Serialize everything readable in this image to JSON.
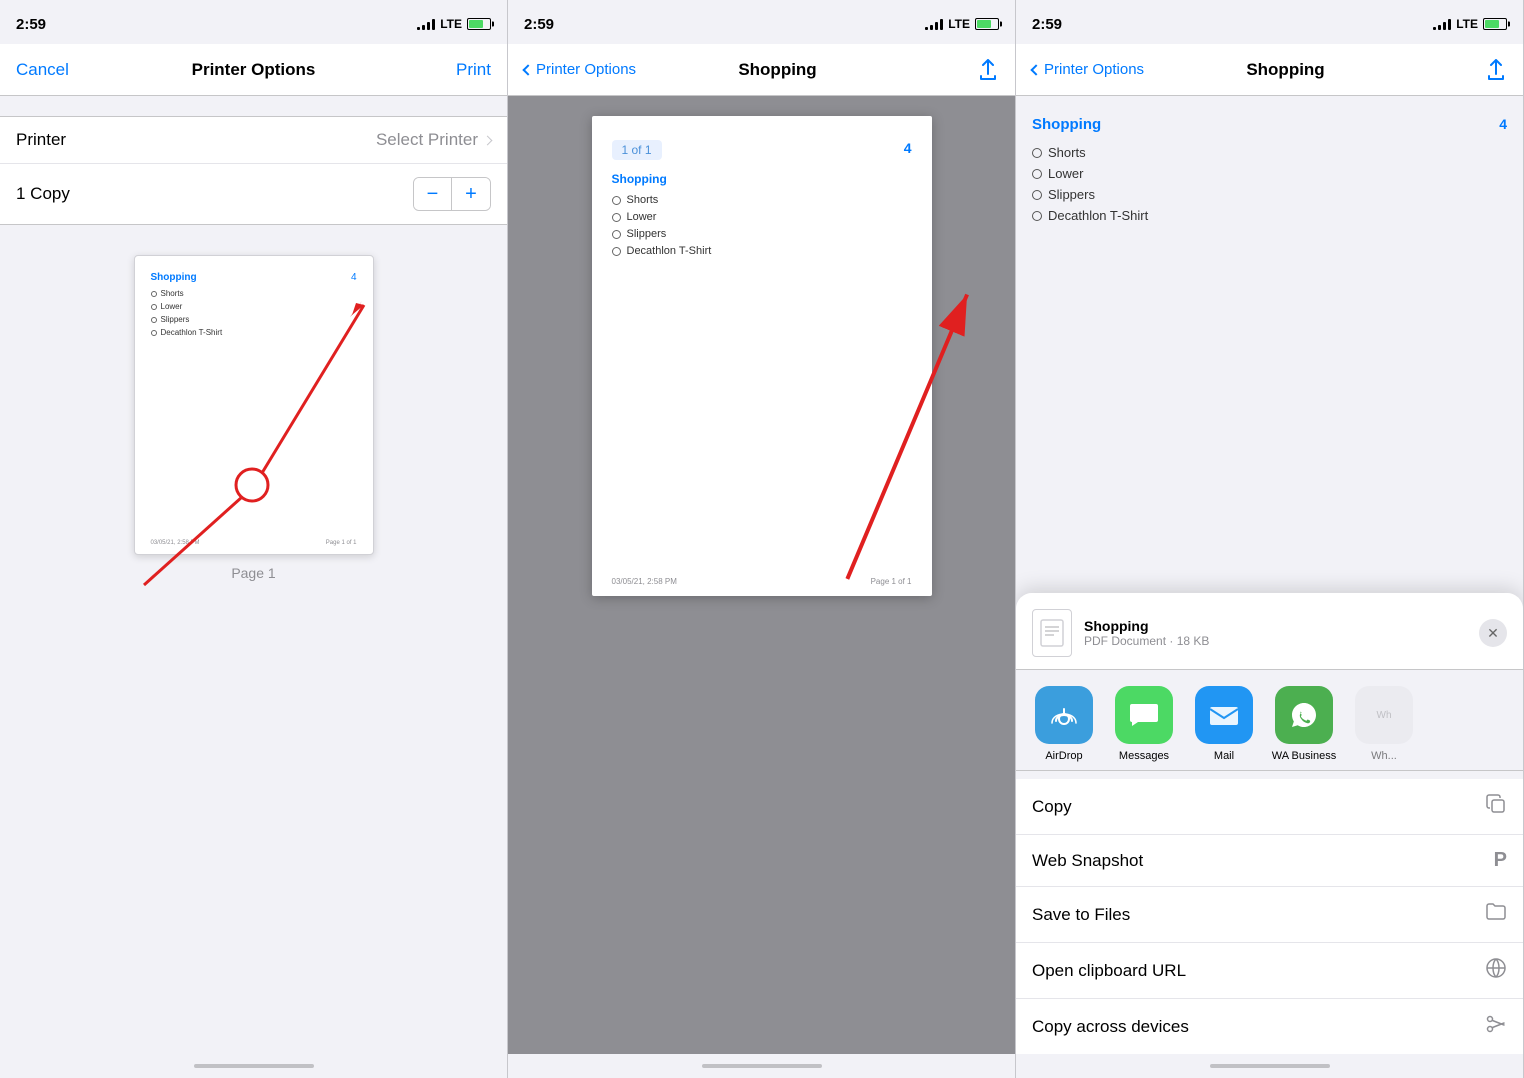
{
  "statusBar": {
    "time": "2:59",
    "lte": "LTE"
  },
  "panel1": {
    "navCancel": "Cancel",
    "navTitle": "Printer Options",
    "navPrint": "Print",
    "printerLabel": "Printer",
    "printerValue": "Select Printer",
    "copyLabel": "1 Copy",
    "pageLabel": "Page 1",
    "docTitle": "Shopping",
    "docNumber": "4",
    "docItems": [
      "Shorts",
      "Lower",
      "Slippers",
      "Decathlon T-Shirt"
    ]
  },
  "panel2": {
    "navBack": "Printer Options",
    "navTitle": "Shopping",
    "pageBadge": "1 of 1",
    "pageNumber": "4",
    "docTitle": "Shopping",
    "docItems": [
      "Shorts",
      "Lower",
      "Slippers",
      "Decathlon T-Shirt"
    ],
    "docDate": "03/05/21, 2:58 PM",
    "docPageNum": "Page 1 of 1"
  },
  "panel3": {
    "navBack": "Printer Options",
    "navTitle": "Shopping",
    "docTitle": "Shopping",
    "docNumber": "4",
    "docItems": [
      "Shorts",
      "Lower",
      "Slippers",
      "Decathlon T-Shirt"
    ],
    "shareDoc": {
      "name": "Shopping",
      "meta": "PDF Document · 18 KB"
    },
    "shareApps": [
      {
        "name": "AirDrop",
        "icon": "airdrop"
      },
      {
        "name": "Messages",
        "icon": "messages"
      },
      {
        "name": "Mail",
        "icon": "mail"
      },
      {
        "name": "WA Business",
        "icon": "wa"
      }
    ],
    "shareActions": [
      {
        "label": "Copy",
        "icon": "copy"
      },
      {
        "label": "Web Snapshot",
        "icon": "web-snapshot"
      },
      {
        "label": "Save to Files",
        "icon": "save-files"
      },
      {
        "label": "Open clipboard URL",
        "icon": "globe"
      },
      {
        "label": "Copy across devices",
        "icon": "scissors"
      }
    ]
  }
}
